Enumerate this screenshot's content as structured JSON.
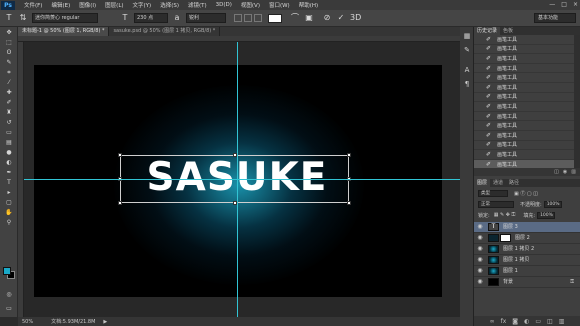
{
  "menubar": {
    "logo": "Ps",
    "items": [
      "文件(F)",
      "编辑(E)",
      "图像(I)",
      "图层(L)",
      "文字(Y)",
      "选择(S)",
      "滤镜(T)",
      "3D(D)",
      "视图(V)",
      "窗口(W)",
      "帮助(H)"
    ],
    "window_controls": [
      "—",
      "□",
      "×"
    ]
  },
  "options": {
    "font_family": "迷你简菱心",
    "font_style": "regular",
    "font_size": "230 点",
    "antialias": "锐利",
    "workspace": "基本功能"
  },
  "document_tabs": [
    {
      "label": "未标题-1 @ 50% (图层 1, RGB/8) *",
      "active": true
    },
    {
      "label": "sasuke.psd @ 50% (图层 1 拷贝, RGB/8) *",
      "active": false
    }
  ],
  "canvas": {
    "text": "SASUKE",
    "background": "#000000",
    "glow_color": "#1aa9c8",
    "guide_color": "#31c4d4"
  },
  "status": {
    "zoom": "50%",
    "doc_size": "文档:5.93M/21.8M"
  },
  "history": {
    "tabs": [
      "历史记录",
      "色板"
    ],
    "items": [
      "画笔工具",
      "画笔工具",
      "画笔工具",
      "画笔工具",
      "画笔工具",
      "画笔工具",
      "画笔工具",
      "画笔工具",
      "画笔工具",
      "画笔工具",
      "画笔工具",
      "画笔工具",
      "画笔工具",
      "画笔工具"
    ],
    "selected_index": 13
  },
  "layers": {
    "tabs": [
      "图层",
      "通道",
      "路径"
    ],
    "kind_filter": "类型",
    "blend_mode": "正常",
    "opacity_label": "不透明度:",
    "opacity": "100%",
    "fill_label": "填充:",
    "fill": "100%",
    "lock_label": "锁定:",
    "items": [
      {
        "name": "图层 3",
        "thumb": "text",
        "selected": true
      },
      {
        "name": "图层 2",
        "thumb": "mask",
        "selected": false
      },
      {
        "name": "图层 1 拷贝 2",
        "thumb": "glow",
        "selected": false
      },
      {
        "name": "图层 1 拷贝",
        "thumb": "glow",
        "selected": false
      },
      {
        "name": "图层 1",
        "thumb": "glow",
        "selected": false
      },
      {
        "name": "背景",
        "thumb": "black",
        "selected": false
      }
    ]
  }
}
